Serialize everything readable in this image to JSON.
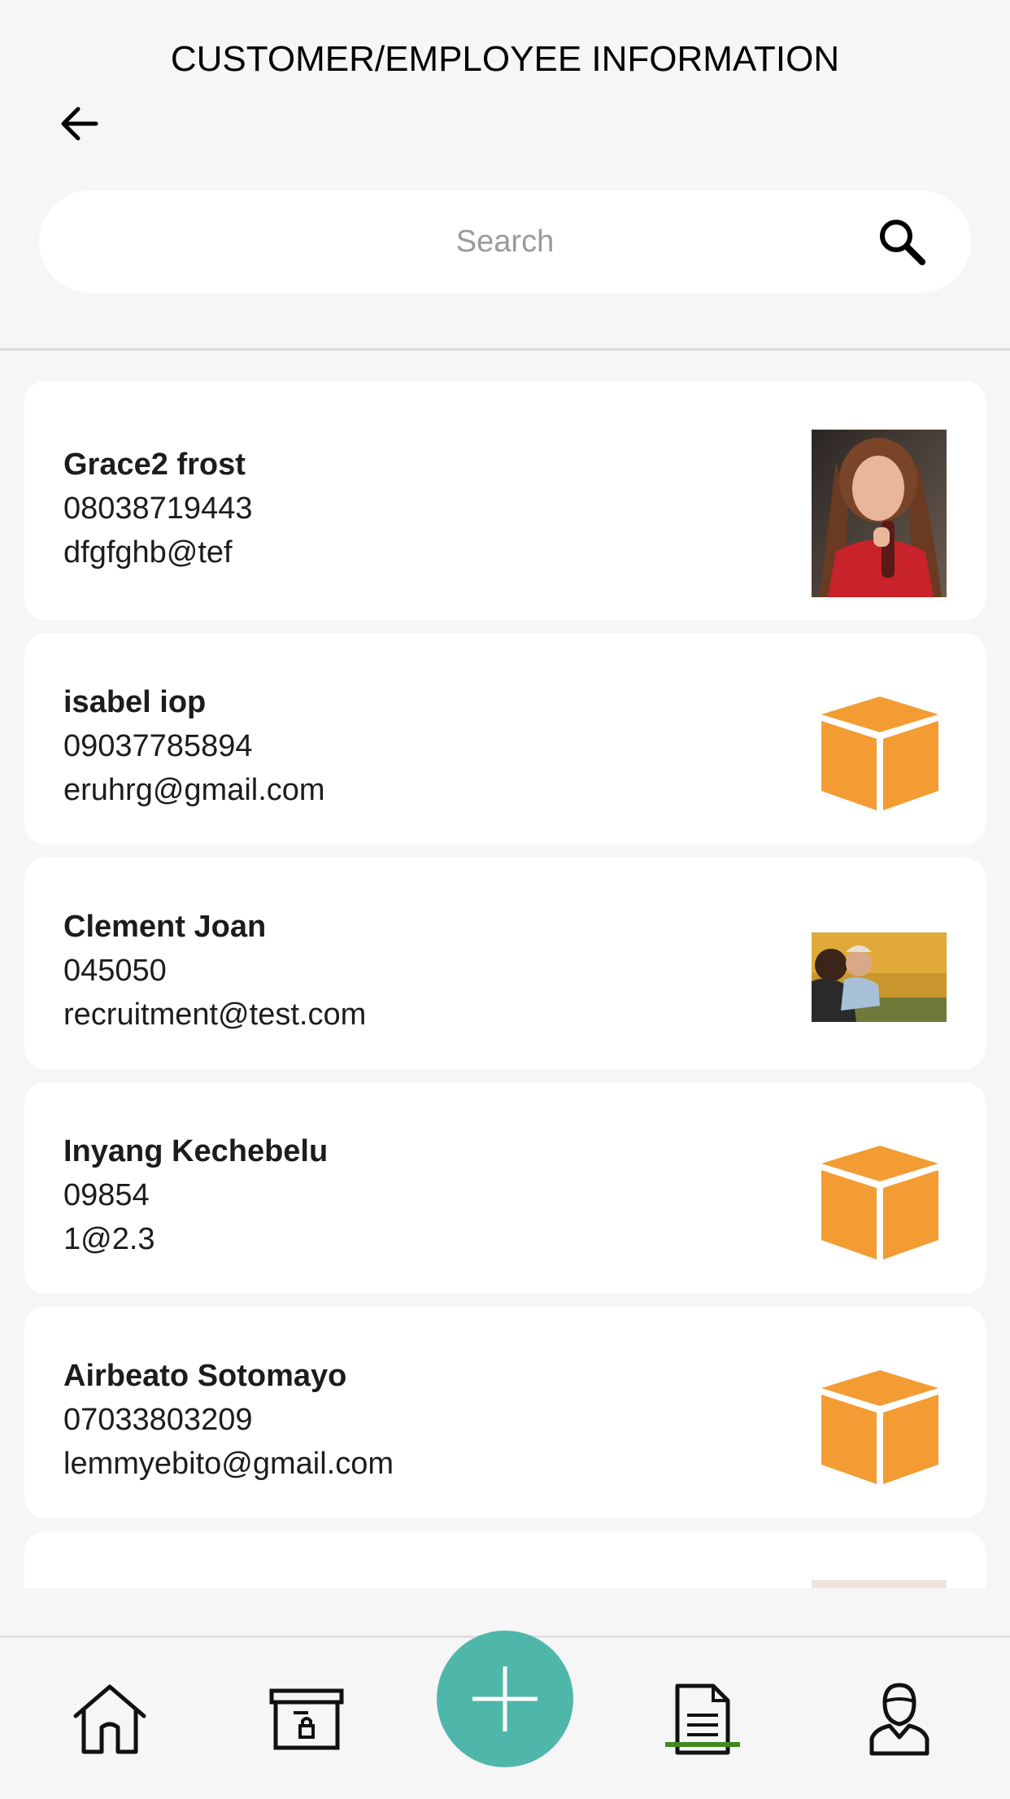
{
  "header": {
    "title": "CUSTOMER/EMPLOYEE INFORMATION"
  },
  "search": {
    "placeholder": "Search",
    "value": ""
  },
  "contacts": [
    {
      "name": "Grace2 frost",
      "phone": "08038719443",
      "email": "dfgfghb@tef",
      "thumbnail": "photo-portrait"
    },
    {
      "name": "isabel iop",
      "phone": "09037785894",
      "email": "eruhrg@gmail.com",
      "thumbnail": "box-icon"
    },
    {
      "name": "Clement Joan",
      "phone": "045050",
      "email": "recruitment@test.com",
      "thumbnail": "photo-family"
    },
    {
      "name": "Inyang Kechebelu",
      "phone": "09854",
      "email": "1@2.3",
      "thumbnail": "box-icon"
    },
    {
      "name": "Airbeato Sotomayo",
      "phone": "07033803209",
      "email": "lemmyebito@gmail.com",
      "thumbnail": "box-icon"
    },
    {
      "name": "",
      "phone": "",
      "email": "",
      "thumbnail": "photo-partial"
    }
  ],
  "bottom_nav": {
    "items": [
      "home-icon",
      "lockbox-icon",
      "add-icon",
      "document-icon",
      "profile-icon"
    ],
    "active": "document-icon"
  },
  "colors": {
    "background": "#f6f6f6",
    "card": "#ffffff",
    "fab": "#4fb6aa",
    "box_orange": "#f39c34",
    "active_underline": "#3f8a1a"
  }
}
